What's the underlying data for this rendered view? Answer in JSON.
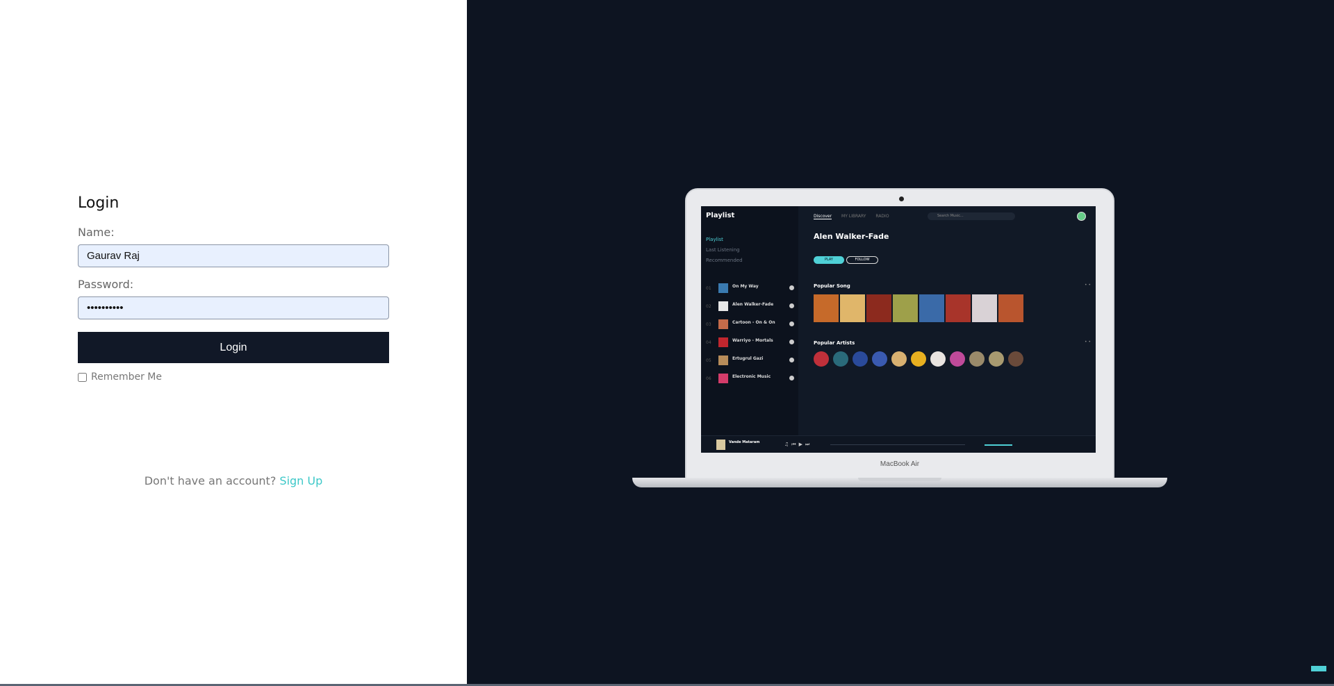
{
  "login": {
    "title": "Login",
    "name_label": "Name:",
    "name_value": "Gaurav Raj",
    "password_label": "Password:",
    "password_value": "••••••••••",
    "submit_label": "Login",
    "remember_label": "Remember Me",
    "signup_prompt": "Don't have an account?",
    "signup_link": "Sign Up"
  },
  "laptop": {
    "brand": "MacBook Air",
    "app": {
      "logo": "Playlist",
      "nav": [
        "Playlist",
        "Last Listening",
        "Recommended"
      ],
      "tabs": [
        "Discover",
        "MY LIBRARY",
        "RADIO"
      ],
      "search_placeholder": "Search Music...",
      "heading": "Alen Walker-Fade",
      "play_label": "PLAY",
      "follow_label": "FOLLOW",
      "popular_songs": "Popular Song",
      "popular_artists": "Popular Artists",
      "tracks": [
        {
          "num": "01",
          "title": "On My Way"
        },
        {
          "num": "02",
          "title": "Alen Walker-Fade"
        },
        {
          "num": "03",
          "title": "Cartoon - On & On"
        },
        {
          "num": "04",
          "title": "Warriyo - Mortals"
        },
        {
          "num": "05",
          "title": "Ertugrul Gazi"
        },
        {
          "num": "06",
          "title": "Electronic Music"
        }
      ],
      "now_playing": "Vande Mataram"
    }
  },
  "colors": {
    "accent": "#4fd0d6",
    "button_dark": "#111827",
    "panel_dark": "#0d1421"
  }
}
